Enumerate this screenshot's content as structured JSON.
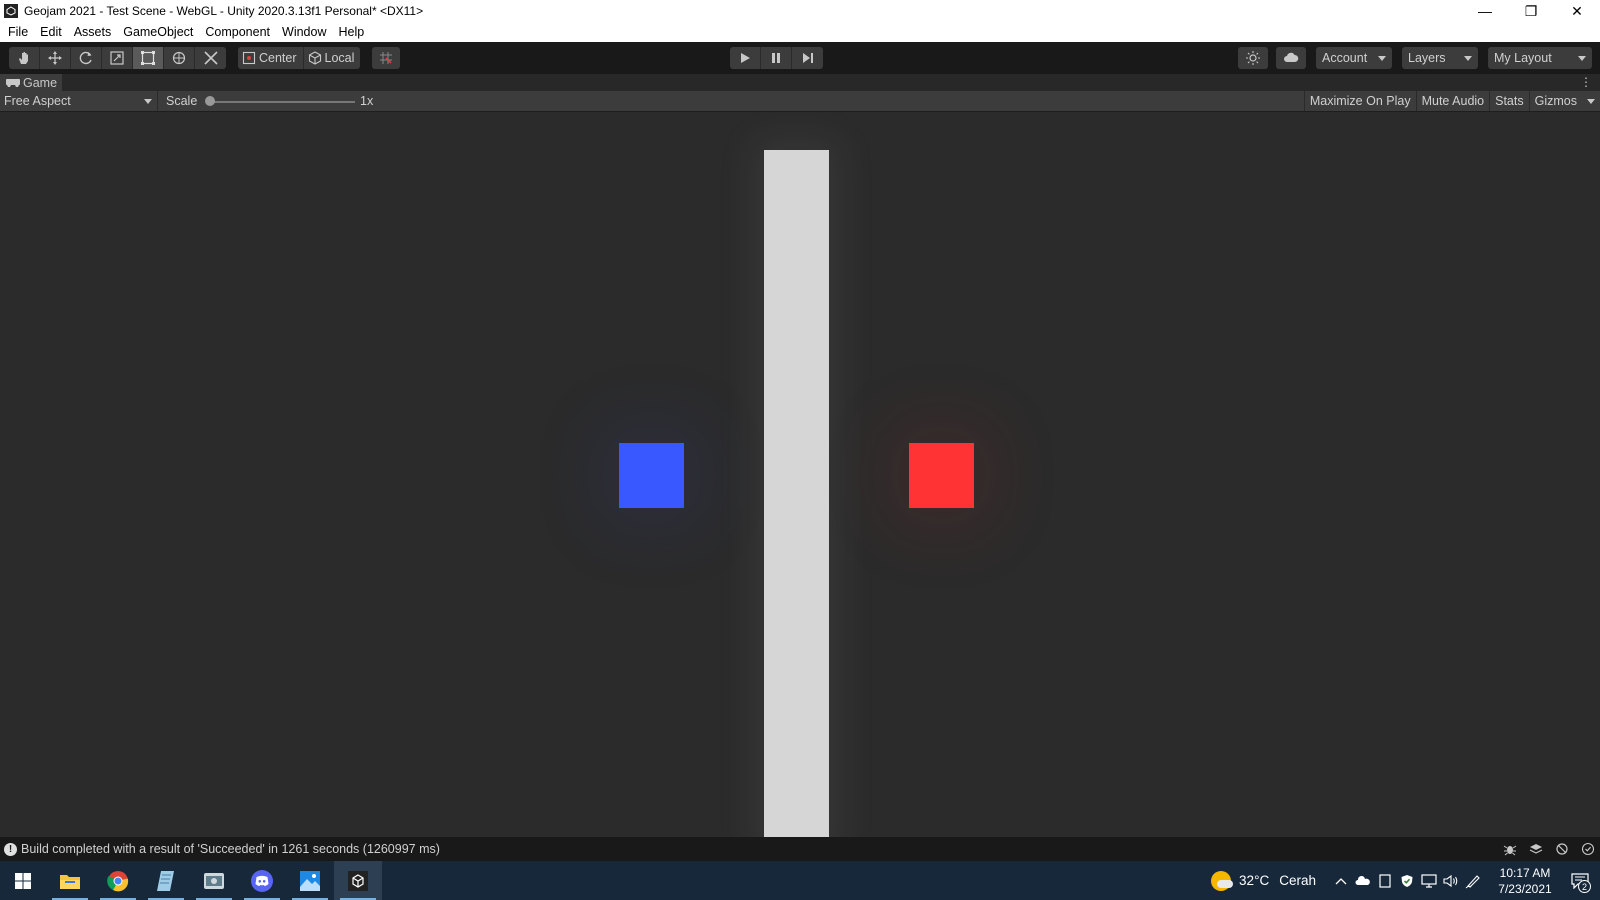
{
  "window": {
    "title": "Geojam 2021 - Test Scene - WebGL - Unity 2020.3.13f1 Personal* <DX11>",
    "minimize_glyph": "—",
    "restore_glyph": "❐",
    "close_glyph": "✕"
  },
  "menu": [
    "File",
    "Edit",
    "Assets",
    "GameObject",
    "Component",
    "Window",
    "Help"
  ],
  "toolbar": {
    "tools": [
      "hand-tool",
      "move-tool",
      "rotate-tool",
      "scale-tool",
      "rect-tool",
      "transform-tool",
      "custom-tool"
    ],
    "active_tool": "rect-tool",
    "pivot_mode": "Center",
    "pivot_rotation": "Local",
    "account_label": "Account",
    "layers_label": "Layers",
    "layout_label": "My Layout"
  },
  "game_view": {
    "tab_label": "Game",
    "aspect": "Free Aspect",
    "scale_label": "Scale",
    "scale_value": "1x",
    "scale_fraction": 0.0,
    "buttons": [
      "Maximize On Play",
      "Mute Audio",
      "Stats",
      "Gizmos"
    ]
  },
  "scene_colors": {
    "background": "#2b2b2b",
    "pillar": "#d6d6d6",
    "left_square": "#3a58ff",
    "right_square": "#ff3333"
  },
  "status": {
    "message": "Build completed with a result of 'Succeeded' in 1261 seconds (1260997 ms)"
  },
  "taskbar": {
    "apps": [
      "file-explorer",
      "chrome",
      "notepad",
      "steam",
      "discord",
      "photos",
      "unity"
    ],
    "weather_temp": "32°C",
    "weather_desc": "Cerah",
    "time": "10:17 AM",
    "date": "7/23/2021",
    "notification_count": "2"
  }
}
